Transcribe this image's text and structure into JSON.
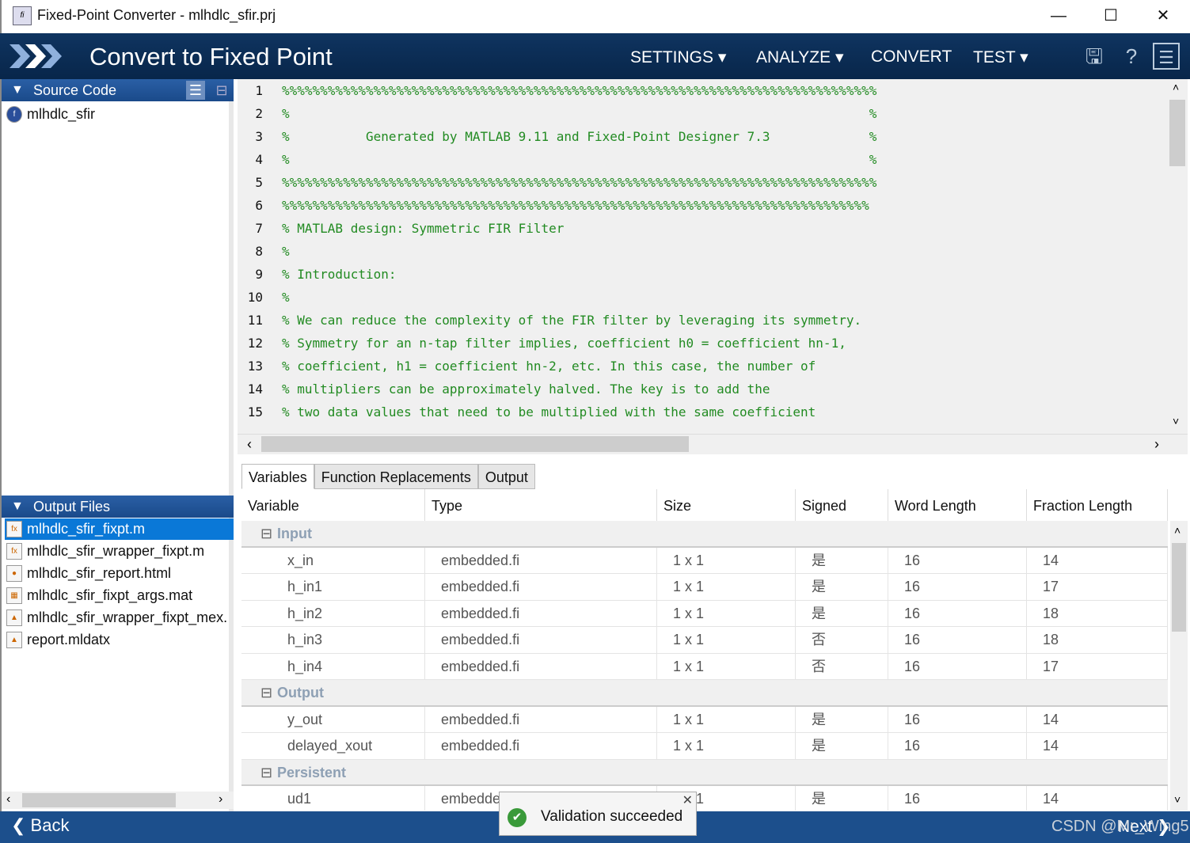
{
  "window": {
    "title": "Fixed-Point Converter - mlhdlc_sfir.prj"
  },
  "header": {
    "title": "Convert to Fixed Point",
    "menus": [
      "SETTINGS ▾",
      "ANALYZE ▾",
      "CONVERT",
      "TEST ▾"
    ]
  },
  "source_code": {
    "label": "Source Code",
    "items": [
      "mlhdlc_sfir"
    ]
  },
  "output_files": {
    "label": "Output Files",
    "selected": 0,
    "items": [
      {
        "name": "mlhdlc_sfir_fixpt.m",
        "icon": "fx"
      },
      {
        "name": "mlhdlc_sfir_wrapper_fixpt.m",
        "icon": "fx"
      },
      {
        "name": "mlhdlc_sfir_report.html",
        "icon": "html"
      },
      {
        "name": "mlhdlc_sfir_fixpt_args.mat",
        "icon": "mat"
      },
      {
        "name": "mlhdlc_sfir_wrapper_fixpt_mex.",
        "icon": "mex"
      },
      {
        "name": "report.mldatx",
        "icon": "mldatx"
      }
    ]
  },
  "code_lines": [
    "%%%%%%%%%%%%%%%%%%%%%%%%%%%%%%%%%%%%%%%%%%%%%%%%%%%%%%%%%%%%%%%%%%%%%%%%%%%%%%",
    "%                                                                            %",
    "%          Generated by MATLAB 9.11 and Fixed-Point Designer 7.3             %",
    "%                                                                            %",
    "%%%%%%%%%%%%%%%%%%%%%%%%%%%%%%%%%%%%%%%%%%%%%%%%%%%%%%%%%%%%%%%%%%%%%%%%%%%%%%",
    "%%%%%%%%%%%%%%%%%%%%%%%%%%%%%%%%%%%%%%%%%%%%%%%%%%%%%%%%%%%%%%%%%%%%%%%%%%%%%",
    "% MATLAB design: Symmetric FIR Filter",
    "%",
    "% Introduction:",
    "%",
    "% We can reduce the complexity of the FIR filter by leveraging its symmetry.",
    "% Symmetry for an n-tap filter implies, coefficient h0 = coefficient hn-1,",
    "% coefficient, h1 = coefficient hn-2, etc. In this case, the number of",
    "% multipliers can be approximately halved. The key is to add the",
    "% two data values that need to be multiplied with the same coefficient"
  ],
  "colors": {
    "comment": "#228b22",
    "header": "#0f3460",
    "selection": "#0a78d7",
    "bottom_bar": "#1c4f8c"
  },
  "tabs": [
    "Variables",
    "Function Replacements",
    "Output"
  ],
  "active_tab": 0,
  "table": {
    "columns": [
      "Variable",
      "Type",
      "Size",
      "Signed",
      "Word Length",
      "Fraction Length"
    ],
    "groups": [
      {
        "name": "Input",
        "rows": [
          [
            "x_in",
            "embedded.fi",
            "1 x 1",
            "是",
            "16",
            "14"
          ],
          [
            "h_in1",
            "embedded.fi",
            "1 x 1",
            "是",
            "16",
            "17"
          ],
          [
            "h_in2",
            "embedded.fi",
            "1 x 1",
            "是",
            "16",
            "18"
          ],
          [
            "h_in3",
            "embedded.fi",
            "1 x 1",
            "否",
            "16",
            "18"
          ],
          [
            "h_in4",
            "embedded.fi",
            "1 x 1",
            "否",
            "16",
            "17"
          ]
        ]
      },
      {
        "name": "Output",
        "rows": [
          [
            "y_out",
            "embedded.fi",
            "1 x 1",
            "是",
            "16",
            "14"
          ],
          [
            "delayed_xout",
            "embedded.fi",
            "1 x 1",
            "是",
            "16",
            "14"
          ]
        ]
      },
      {
        "name": "Persistent",
        "rows": [
          [
            "ud1",
            "embedded.fi",
            "1 x 1",
            "是",
            "16",
            "14"
          ]
        ]
      }
    ]
  },
  "footer": {
    "back": "Back",
    "next": "Next",
    "watermark": "CSDN @Mr_Wing5"
  },
  "toast": {
    "message": "Validation succeeded"
  }
}
